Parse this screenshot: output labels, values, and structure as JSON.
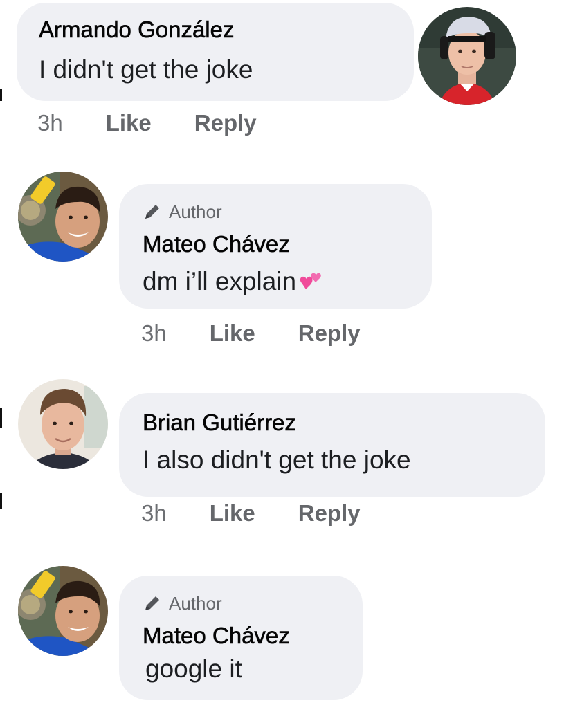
{
  "comments": [
    {
      "avatar_icon": "avatar-armando",
      "name": "Armando González",
      "text": "I didn't get the joke",
      "time": "3h",
      "like": "Like",
      "reply": "Reply"
    },
    {
      "avatar_icon": "avatar-mateo",
      "author_tag": "Author",
      "name": "Mateo Chávez",
      "text": "dm i’ll explain",
      "emoji_icon": "two-hearts-icon",
      "time": "3h",
      "like": "Like",
      "reply": "Reply"
    },
    {
      "avatar_icon": "avatar-brian",
      "name": "Brian Gutiérrez",
      "text": "I also didn't get the joke",
      "time": "3h",
      "like": "Like",
      "reply": "Reply"
    },
    {
      "avatar_icon": "avatar-mateo",
      "author_tag": "Author",
      "name": "Mateo Chávez",
      "text": "google it"
    }
  ],
  "colors": {
    "bubble": "#eff0f4",
    "meta_text": "#65676b",
    "name_text": "#050505",
    "heart_pink": "#f04a9a"
  }
}
